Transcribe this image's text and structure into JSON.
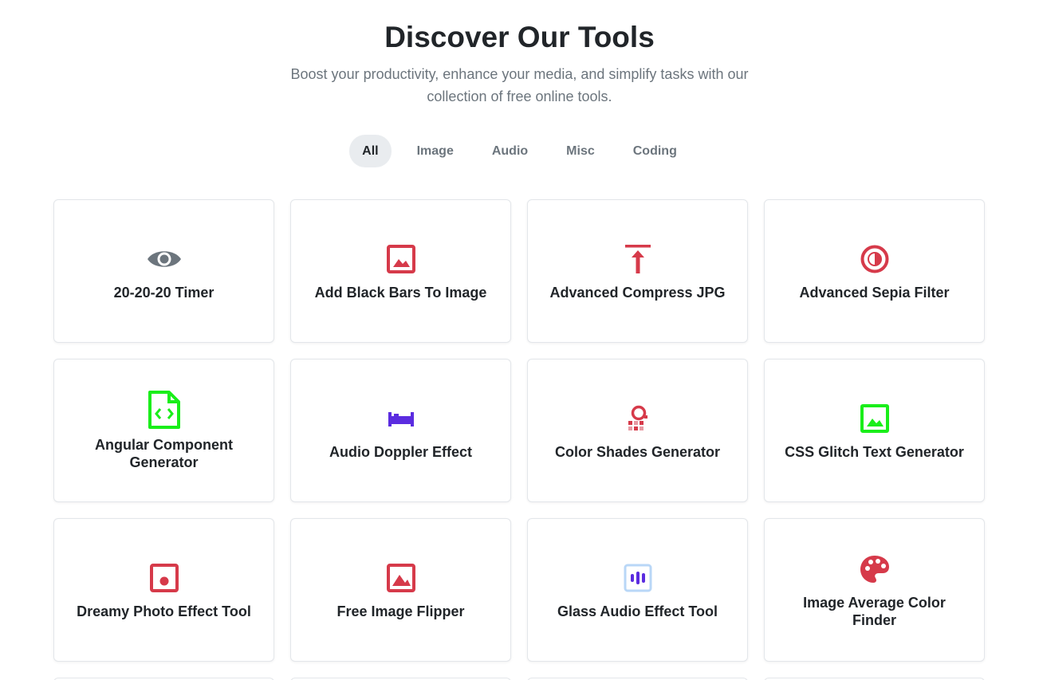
{
  "header": {
    "title": "Discover Our Tools",
    "subtitle": "Boost your productivity, enhance your media, and simplify tasks with our collection of free online tools."
  },
  "filters": [
    {
      "label": "All",
      "active": true
    },
    {
      "label": "Image",
      "active": false
    },
    {
      "label": "Audio",
      "active": false
    },
    {
      "label": "Misc",
      "active": false
    },
    {
      "label": "Coding",
      "active": false
    }
  ],
  "colors": {
    "red": "#d63a4a",
    "gray": "#6c757d",
    "green": "#1aee1a",
    "purple": "#5b2ce0",
    "light_blue": "#b9d7f7"
  },
  "tools": [
    {
      "label": "20-20-20 Timer",
      "icon": "eye-icon"
    },
    {
      "label": "Add Black Bars To Image",
      "icon": "image-icon"
    },
    {
      "label": "Advanced Compress JPG",
      "icon": "upload-arrow-icon"
    },
    {
      "label": "Advanced Sepia Filter",
      "icon": "contrast-circle-icon"
    },
    {
      "label": "Angular Component Generator",
      "icon": "code-file-icon"
    },
    {
      "label": "Audio Doppler Effect",
      "icon": "bed-icon"
    },
    {
      "label": "Color Shades Generator",
      "icon": "color-shades-icon"
    },
    {
      "label": "CSS Glitch Text Generator",
      "icon": "image-frame-icon"
    },
    {
      "label": "Dreamy Photo Effect Tool",
      "icon": "dot-square-icon"
    },
    {
      "label": "Free Image Flipper",
      "icon": "mountain-image-icon"
    },
    {
      "label": "Glass Audio Effect Tool",
      "icon": "audio-bars-icon"
    },
    {
      "label": "Image Average Color Finder",
      "icon": "palette-icon"
    }
  ]
}
